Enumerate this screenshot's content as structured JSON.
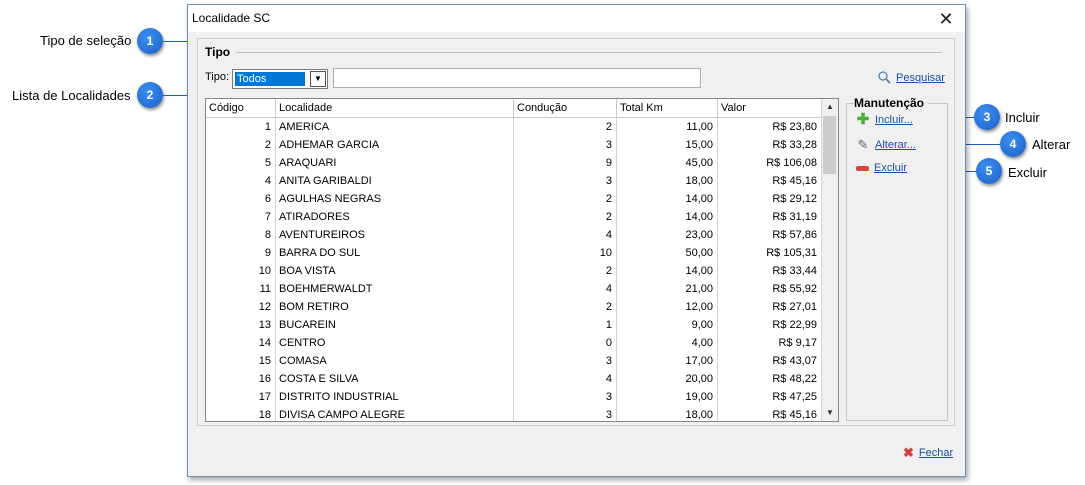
{
  "callouts": [
    {
      "num": "1",
      "label": "Tipo de seleção"
    },
    {
      "num": "2",
      "label": "Lista de Localidades"
    },
    {
      "num": "3",
      "label": "Incluir"
    },
    {
      "num": "4",
      "label": "Alterar"
    },
    {
      "num": "5",
      "label": "Excluir"
    }
  ],
  "window": {
    "title": "Localidade SC",
    "close_glyph": "✕"
  },
  "tipo_group": {
    "title": "Tipo",
    "select_label": "Tipo:",
    "select_value": "Todos",
    "text_value": "",
    "search_label": "Pesquisar"
  },
  "table": {
    "columns": [
      "Código",
      "Localidade",
      "Condução",
      "Total Km",
      "Valor"
    ],
    "rows": [
      [
        "1",
        "AMERICA",
        "2",
        "11,00",
        "R$ 23,80"
      ],
      [
        "2",
        "ADHEMAR GARCIA",
        "3",
        "15,00",
        "R$ 33,28"
      ],
      [
        "5",
        "ARAQUARI",
        "9",
        "45,00",
        "R$ 106,08"
      ],
      [
        "4",
        "ANITA GARIBALDI",
        "3",
        "18,00",
        "R$ 45,16"
      ],
      [
        "6",
        "AGULHAS NEGRAS",
        "2",
        "14,00",
        "R$ 29,12"
      ],
      [
        "7",
        "ATIRADORES",
        "2",
        "14,00",
        "R$ 31,19"
      ],
      [
        "8",
        "AVENTUREIROS",
        "4",
        "23,00",
        "R$ 57,86"
      ],
      [
        "9",
        "BARRA DO SUL",
        "10",
        "50,00",
        "R$ 105,31"
      ],
      [
        "10",
        "BOA VISTA",
        "2",
        "14,00",
        "R$ 33,44"
      ],
      [
        "11",
        "BOEHMERWALDT",
        "4",
        "21,00",
        "R$ 55,92"
      ],
      [
        "12",
        "BOM RETIRO",
        "2",
        "12,00",
        "R$ 27,01"
      ],
      [
        "13",
        "BUCAREIN",
        "1",
        "9,00",
        "R$ 22,99"
      ],
      [
        "14",
        "CENTRO",
        "0",
        "4,00",
        "R$ 9,17"
      ],
      [
        "15",
        "COMASA",
        "3",
        "17,00",
        "R$ 43,07"
      ],
      [
        "16",
        "COSTA E SILVA",
        "4",
        "20,00",
        "R$ 48,22"
      ],
      [
        "17",
        "DISTRITO INDUSTRIAL",
        "3",
        "19,00",
        "R$ 47,25"
      ],
      [
        "18",
        "DIVISA CAMPO ALEGRE",
        "3",
        "18,00",
        "R$ 45,16"
      ]
    ]
  },
  "manutencao": {
    "title": "Manutenção",
    "incluir": "Incluir...",
    "alterar": "Alterar...",
    "excluir": "Excluir"
  },
  "footer": {
    "fechar": "Fechar"
  },
  "colors": {
    "accent": "#1a5fc8",
    "link": "#1a4fa8",
    "selection": "#0078d7"
  }
}
